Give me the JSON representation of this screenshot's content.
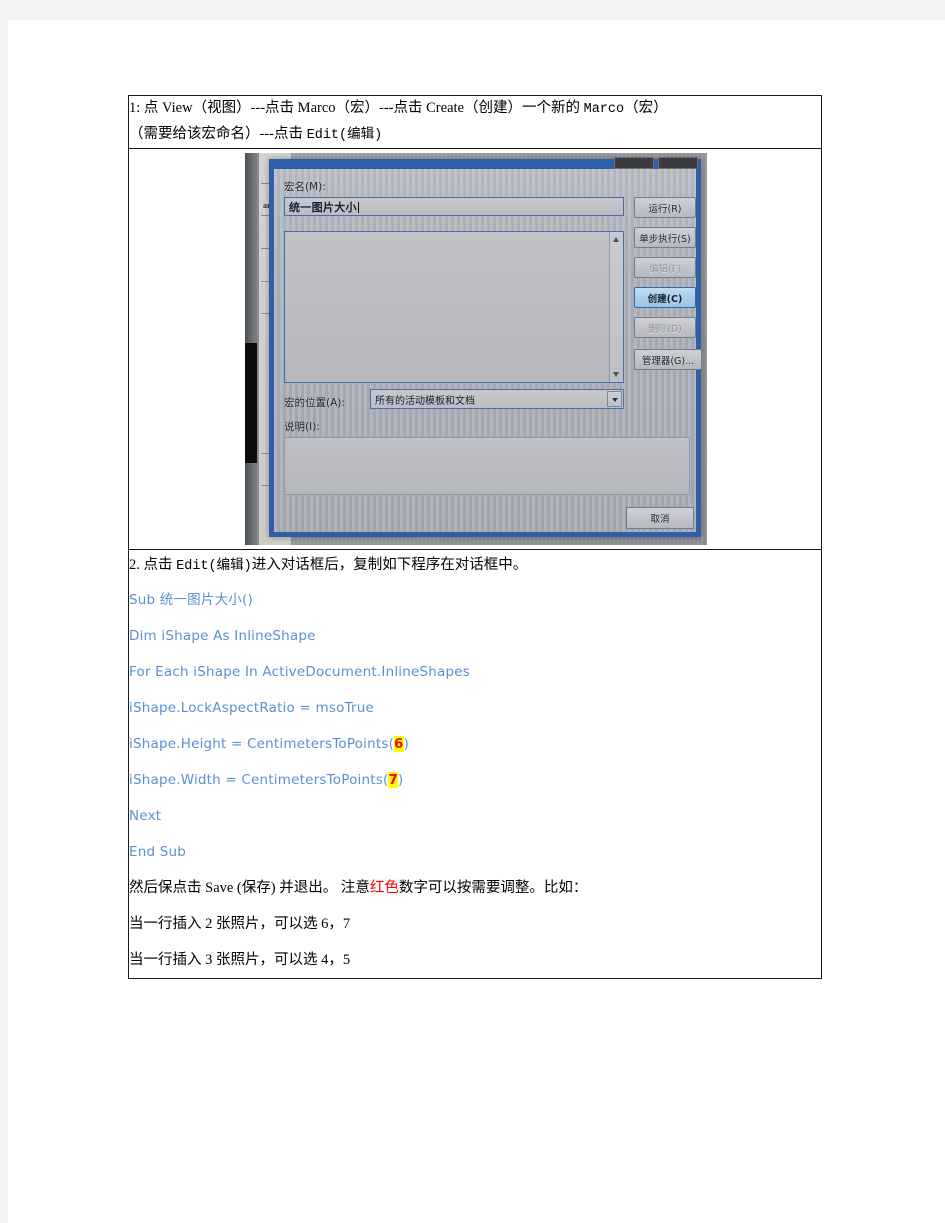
{
  "document": {
    "step1": {
      "line1": "1: 点 View（视图）---点击 Marco（宏）---点击 Create（创建）一个新的 Marco（宏）",
      "line1_parts": {
        "a": "1: 点 View（视图）---点击 Marco（宏）---点击 Create（创建）一个新的 ",
        "b": "Marco",
        "c": "（宏）"
      },
      "line2_parts": {
        "a": "（需要给该宏命名）---点击 ",
        "b": "Edit",
        "c": "(编辑)"
      }
    },
    "photo": {
      "caption_semantic": "photo-of-word-macros-dialog",
      "dialog": {
        "macro_name_label": "宏名(M):",
        "macro_name_value": "统一图片大小",
        "location_label": "宏的位置(A):",
        "location_value": "所有的活动模板和文档",
        "description_label": "说明(I):",
        "buttons": [
          {
            "label": "运行(R)",
            "state": "normal"
          },
          {
            "label": "单步执行(S)",
            "state": "normal"
          },
          {
            "label": "编辑(F)",
            "state": "dim"
          },
          {
            "label": "创建(C)",
            "state": "selected"
          },
          {
            "label": "删除(D)",
            "state": "disabled"
          },
          {
            "label": "管理器(G)...",
            "state": "normal"
          }
        ],
        "cancel_label": "取消"
      },
      "background_doc_text": "ar"
    },
    "step2": {
      "intro_parts": {
        "a": "2. 点击 ",
        "b": "Edit(编辑)",
        "c": "进入对话框后，复制如下程序在对话框中。"
      },
      "code_lines": [
        {
          "text": "Sub 统一图片大小()"
        },
        {
          "text": "Dim  iShape  As  InlineShape"
        },
        {
          "text": "For  Each  iShape  In  ActiveDocument.InlineShapes"
        },
        {
          "text": "iShape.LockAspectRatio  =  msoTrue"
        },
        {
          "pre": "iShape.Height  =  CentimetersToPoints(",
          "highlight": "6",
          "post": ")"
        },
        {
          "pre": "iShape.Width  =  CentimetersToPoints(",
          "highlight": "7",
          "post": ")"
        },
        {
          "text": "Next"
        },
        {
          "text": "End  Sub"
        }
      ],
      "note_parts": {
        "a": "然后保点击 Save (保存) 并退出。  注意",
        "red": "红色",
        "b": "数字可以按需要调整。比如："
      },
      "example_line1": "当一行插入 2 张照片，可以选 6，7",
      "example_line2": "当一行插入 3 张照片，可以选 4，5"
    }
  },
  "colors": {
    "code_blue": "#5b8fd4",
    "highlight_yellow": "#ffff00",
    "highlight_text_red": "#ff0000",
    "table_border": "#1a1a1a",
    "dialog_frame_blue": "#2f5fa8"
  }
}
